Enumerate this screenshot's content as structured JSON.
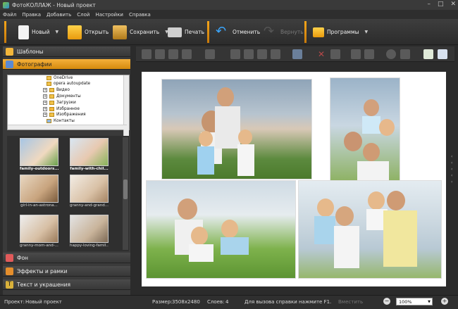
{
  "window": {
    "title": "ФотоКОЛЛАЖ - Новый проект"
  },
  "menu": [
    "Файл",
    "Правка",
    "Добавить",
    "Слой",
    "Настройки",
    "Справка"
  ],
  "toolbar": {
    "new_label": "Новый",
    "open_label": "Открыть",
    "save_label": "Сохранить",
    "print_label": "Печать",
    "undo_label": "Отменить",
    "redo_label": "Вернуть",
    "programs_label": "Программы"
  },
  "left_panel": {
    "templates_label": "Шаблоны",
    "photos_label": "Фотографии",
    "tree": [
      "OneDrive",
      "opera autoupdate",
      "Видео",
      "Документы",
      "Загрузки",
      "Избранное",
      "Изображения",
      "Контакты"
    ],
    "thumbs": [
      "family-outdoors...",
      "family-with-chil...",
      "girl-in-an-astrona...",
      "granny-and-grand...",
      "granny-mom-and-...",
      "happy-loving-famil..."
    ],
    "bg_label": "Фон",
    "effects_label": "Эффекты и рамки",
    "text_label": "Текст и украшения"
  },
  "status": {
    "project_label": "Проект:",
    "project_name": "Новый проект",
    "size_label": "Размер:",
    "size_value": "3508x2480",
    "layers_label": "Слоев:",
    "layers_value": "4",
    "help_text": "Для вызова справки нажмите F1.",
    "fit_label": "Вместить",
    "zoom": "100%"
  }
}
